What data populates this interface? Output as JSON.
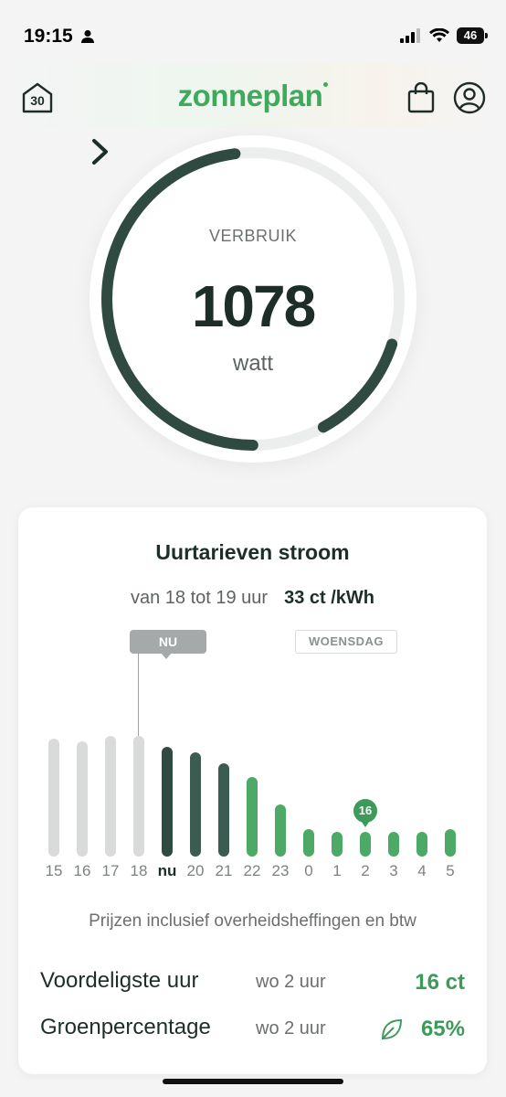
{
  "status": {
    "time": "19:15",
    "battery": "46"
  },
  "header": {
    "home_number": "30",
    "logo": "zonneplan"
  },
  "gauge": {
    "label": "VERBRUIK",
    "value": "1078",
    "unit": "watt",
    "fraction": 0.8
  },
  "card": {
    "title": "Uurtarieven stroom",
    "range": "van 18 tot 19 uur",
    "price": "33 ct /kWh",
    "now_tag": "NU",
    "day_tag": "WOENSDAG",
    "note": "Prijzen inclusief overheidsheffingen en btw",
    "cheapest": {
      "label": "Voordeligste uur",
      "when": "wo 2 uur",
      "value": "16 ct"
    },
    "green": {
      "label": "Groenpercentage",
      "when": "wo 2 uur",
      "value": "65%"
    }
  },
  "chart_data": {
    "type": "bar",
    "categories": [
      "15",
      "16",
      "17",
      "18",
      "nu",
      "20",
      "21",
      "22",
      "23",
      "0",
      "1",
      "2",
      "3",
      "4",
      "5"
    ],
    "values": [
      43,
      42,
      44,
      44,
      40,
      38,
      34,
      29,
      19,
      10,
      9,
      9,
      9,
      9,
      10
    ],
    "highlight": {
      "category": "2",
      "label": "16"
    },
    "colors": {
      "past": "#d9dbda",
      "current": "#2f4a40",
      "high": "#3b5c50",
      "mid": "#4caa66",
      "low": "#4caa66"
    }
  },
  "colors": {
    "brand": "#3daa5c",
    "dark": "#1d2e29",
    "gauge_ring": "#2f4a40"
  },
  "icons": {
    "home": "house-30-icon",
    "bag": "shopping-bag-icon",
    "profile": "user-circle-icon",
    "chevron": "chevron-right-icon",
    "leaf": "leaf-icon"
  }
}
